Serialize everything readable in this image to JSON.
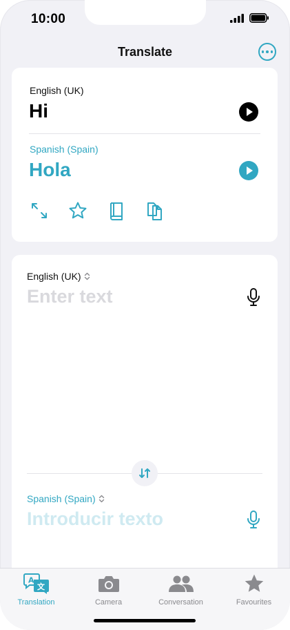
{
  "status": {
    "time": "10:00"
  },
  "header": {
    "title": "Translate"
  },
  "result": {
    "source_language": "English (UK)",
    "source_text": "Hi",
    "target_language": "Spanish (Spain)",
    "target_text": "Hola",
    "actions": [
      "expand-icon",
      "star-icon",
      "book-icon",
      "copy-icon"
    ]
  },
  "input": {
    "source_language": "English (UK)",
    "source_placeholder": "Enter text",
    "target_language": "Spanish (Spain)",
    "target_placeholder": "Introducir texto"
  },
  "tabs": [
    {
      "label": "Translation",
      "icon": "translation-icon",
      "active": true
    },
    {
      "label": "Camera",
      "icon": "camera-icon",
      "active": false
    },
    {
      "label": "Conversation",
      "icon": "people-icon",
      "active": false
    },
    {
      "label": "Favourites",
      "icon": "star-icon",
      "active": false
    }
  ],
  "colors": {
    "accent": "#31a7c2",
    "inactive": "#8a8a8e",
    "background": "#f1f1f6"
  }
}
